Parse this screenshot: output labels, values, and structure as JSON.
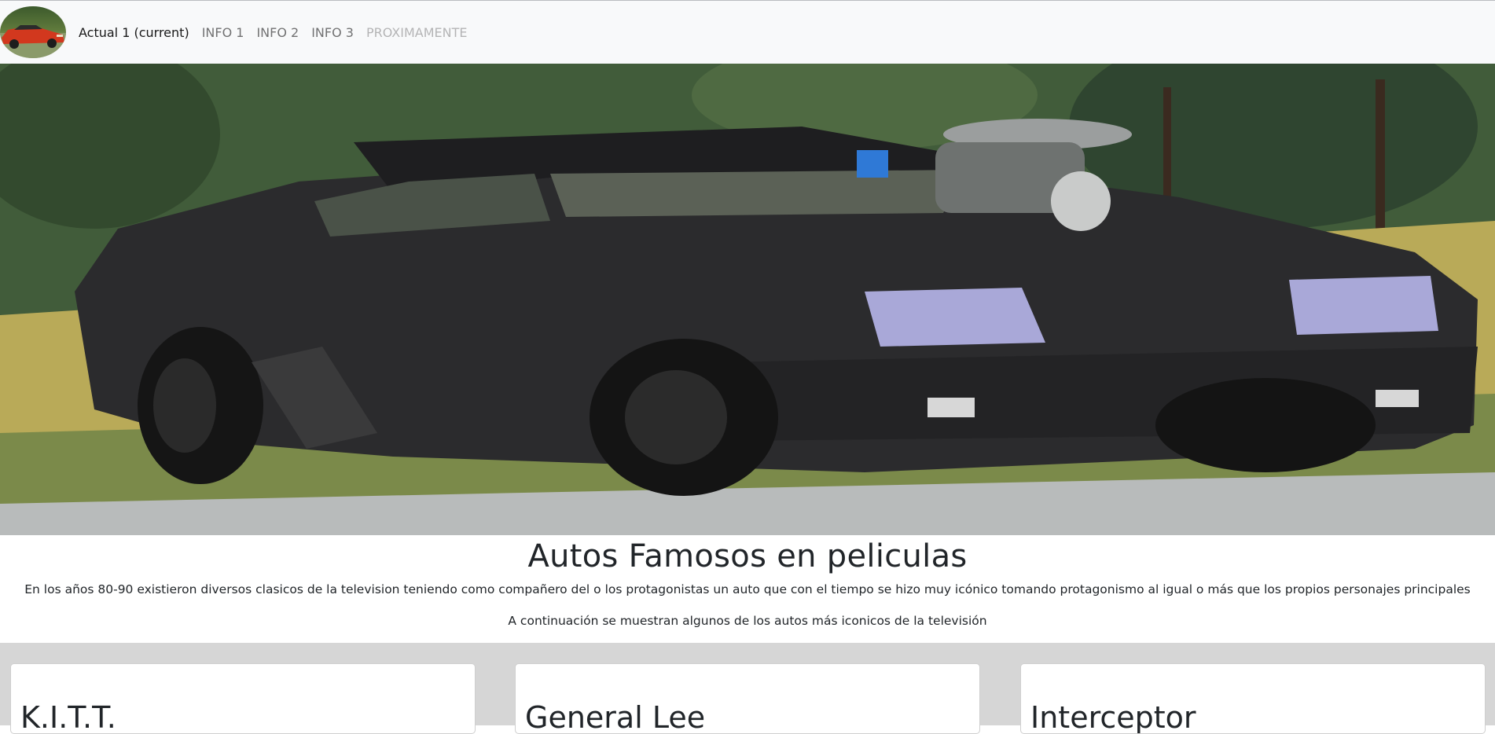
{
  "navbar": {
    "logo_icon": "car-logo-icon",
    "links": [
      {
        "label": "Actual 1 (current)",
        "state": "active"
      },
      {
        "label": "INFO 1",
        "state": "normal"
      },
      {
        "label": "INFO 2",
        "state": "normal"
      },
      {
        "label": "INFO 3",
        "state": "normal"
      },
      {
        "label": "PROXIMAMENTE",
        "state": "disabled"
      }
    ]
  },
  "hero": {
    "image": "black-muscle-car-photo"
  },
  "intro": {
    "title": "Autos Famosos en peliculas",
    "paragraph1": "En los años 80-90 existieron diversos clasicos de la television teniendo como compañero del o los protagonistas un auto que con el tiempo se hizo muy icónico tomando protagonismo al igual o más que los propios personajes principales",
    "paragraph2": "A continuación se muestran algunos de los autos más iconicos de la televisión"
  },
  "cards": [
    {
      "title": "K.I.T.T."
    },
    {
      "title": "General Lee"
    },
    {
      "title": "Interceptor"
    }
  ],
  "colors": {
    "navbar_bg": "#f8f9fa",
    "cards_bg": "#d6d6d6",
    "text": "#212529"
  }
}
